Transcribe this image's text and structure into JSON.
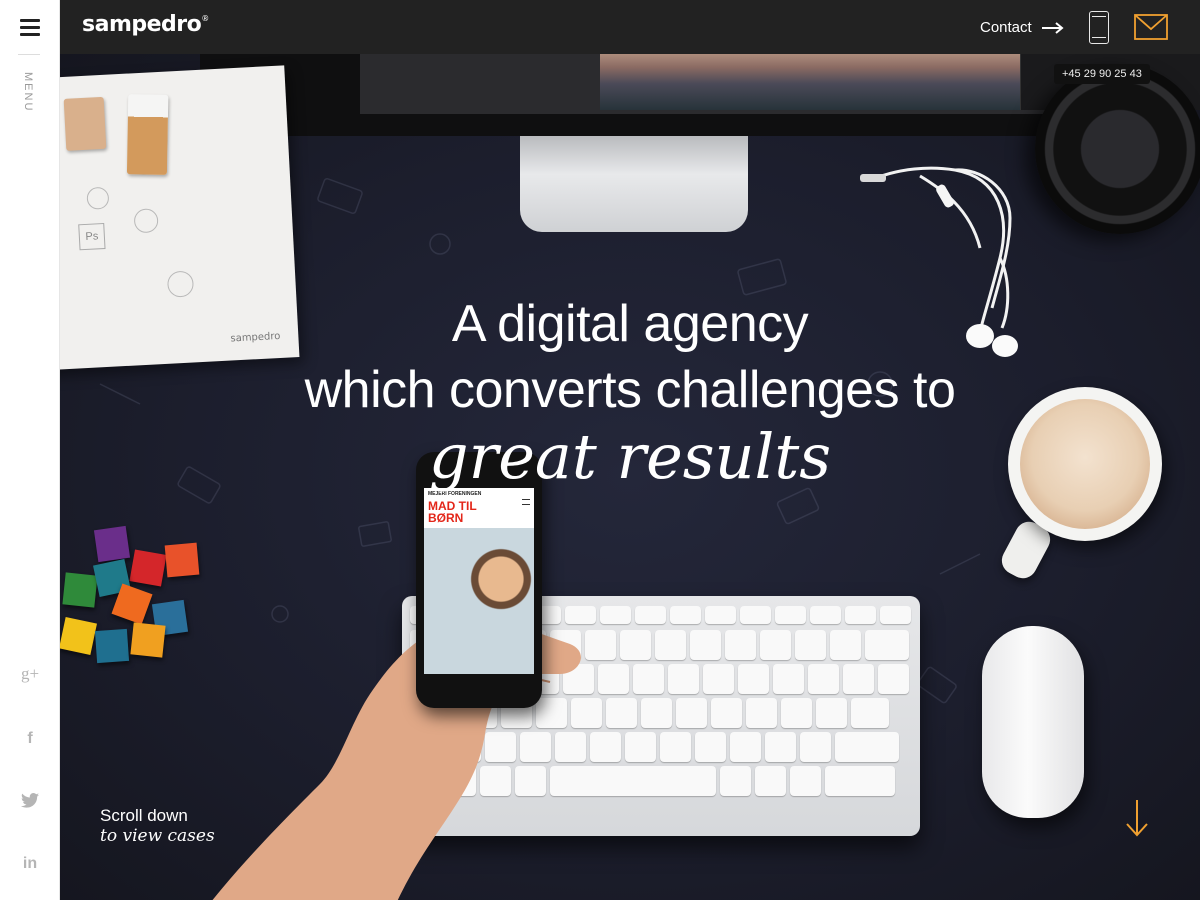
{
  "sidebar": {
    "menu_label": "MENU",
    "social": {
      "gplus": "g+",
      "facebook": "f",
      "linkedin": "in"
    }
  },
  "header": {
    "logo": "sampedro",
    "logo_mark": "®",
    "contact_label": "Contact",
    "phone_number": "+45 29 90 25 43"
  },
  "hero": {
    "line1": "A digital agency",
    "line2": "which converts challenges to",
    "line3": "great results",
    "scroll_line1": "Scroll down",
    "scroll_line2": "to view cases",
    "notebook_signature": "sampedro",
    "ps_stamp": "Ps"
  },
  "phone_screen": {
    "brand": "MEJERI FORENINGEN",
    "headline_line1": "MAD TIL",
    "headline_line2": "BØRN"
  },
  "colors": {
    "topbar": "#222222",
    "accent": "#f0a030",
    "hero_bg": "#1c1e2d",
    "text": "#ffffff"
  },
  "icons": [
    "hamburger-icon",
    "arrow-right-icon",
    "mobile-phone-icon",
    "mail-icon",
    "gplus-icon",
    "facebook-icon",
    "twitter-icon",
    "linkedin-icon",
    "arrow-down-icon"
  ]
}
